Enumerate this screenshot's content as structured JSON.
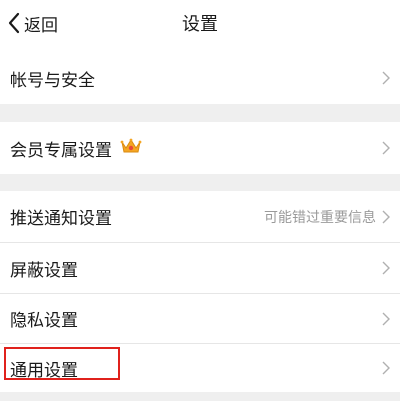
{
  "nav": {
    "back_label": "返回",
    "title": "设置"
  },
  "sections": [
    {
      "items": [
        {
          "label": "帐号与安全"
        }
      ]
    },
    {
      "items": [
        {
          "label": "会员专属设置",
          "icon": "crown-icon"
        }
      ]
    },
    {
      "items": [
        {
          "label": "推送通知设置",
          "hint": "可能错过重要信息"
        },
        {
          "label": "屏蔽设置"
        },
        {
          "label": "隐私设置"
        },
        {
          "label": "通用设置",
          "highlighted": true
        }
      ]
    }
  ],
  "colors": {
    "background": "#efefef",
    "surface": "#ffffff",
    "highlight": "#e0211c",
    "hint_text": "#9a9a9a"
  }
}
